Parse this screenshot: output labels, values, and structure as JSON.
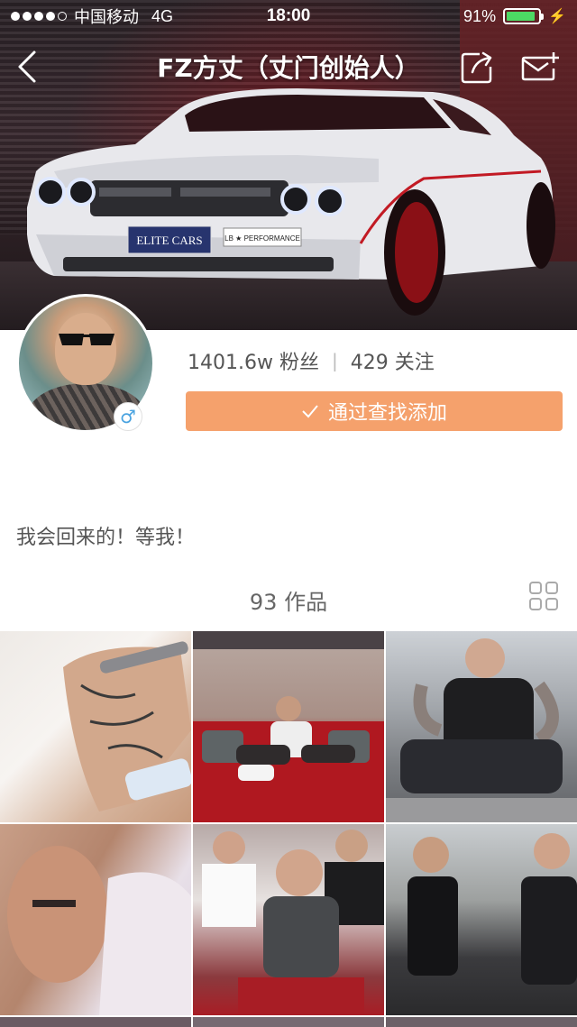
{
  "status_bar": {
    "carrier": "中国移动",
    "network": "4G",
    "time": "18:00",
    "battery": "91%",
    "battery_level": 0.91,
    "signal_filled": 4,
    "signal_total": 5
  },
  "nav": {
    "title": "FZ方丈（丈门创始人）",
    "back_icon": "chevron-left-icon",
    "share_icon": "share-icon",
    "message_icon": "message-add-icon"
  },
  "banner": {
    "plate_text": "ELITE CARS",
    "sticker_text": "LB ★ PERFORMANCE"
  },
  "profile": {
    "followers": "1401.6w 粉丝",
    "following": "429 关注",
    "separator": "|",
    "gender_symbol": "♂",
    "follow_button_label": "通过查找添加",
    "bio": "我会回来的！等我！"
  },
  "works": {
    "label": "93 作品",
    "grid_icon": "grid-view-icon"
  },
  "colors": {
    "accent": "#f5a16c",
    "gender": "#4aa3e0",
    "battery": "#4cd964"
  }
}
